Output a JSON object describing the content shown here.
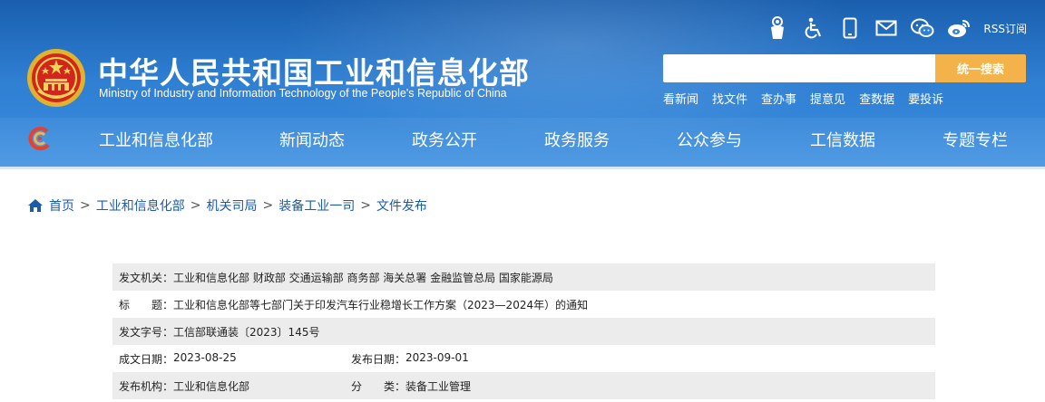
{
  "header": {
    "title": "中华人民共和国工业和信息化部",
    "subtitle": "Ministry of Industry and Information Technology of the People's Republic of China",
    "rss_label": "RSS订阅",
    "tool_icons": [
      "accessibility-service-icon",
      "wheelchair-icon",
      "mobile-icon",
      "mail-icon",
      "wechat-icon",
      "weibo-icon"
    ]
  },
  "search": {
    "placeholder": "",
    "button_label": "统一搜索"
  },
  "quick_links": [
    "看新闻",
    "找文件",
    "查办事",
    "提意见",
    "查数据",
    "要投诉"
  ],
  "nav": {
    "items": [
      "工业和信息化部",
      "新闻动态",
      "政务公开",
      "政务服务",
      "公众参与",
      "工信数据",
      "专题专栏"
    ]
  },
  "breadcrumb": [
    "首页",
    "工业和信息化部",
    "机关司局",
    "装备工业一司",
    "文件发布"
  ],
  "document_info": {
    "issuing_agencies": {
      "label": "发文机关：",
      "value": "工业和信息化部 财政部 交通运输部 商务部 海关总署 金融监管总局 国家能源局"
    },
    "title": {
      "label": "标　　题：",
      "value": "工业和信息化部等七部门关于印发汽车行业稳增长工作方案（2023—2024年）的通知"
    },
    "doc_number": {
      "label": "发文字号：",
      "value": "工信部联通装〔2023〕145号"
    },
    "created_date": {
      "label": "成文日期：",
      "value": "2023-08-25"
    },
    "publish_date": {
      "label": "发布日期：",
      "value": "2023-09-01"
    },
    "publisher": {
      "label": "发布机构：",
      "value": "工业和信息化部"
    },
    "category": {
      "label": "分　　类：",
      "value": "装备工业管理"
    }
  },
  "colors": {
    "header_blue": "#2f7fd3",
    "search_button": "#f3b34a",
    "link_blue": "#1c5ba8",
    "row_shade": "#ececec"
  }
}
